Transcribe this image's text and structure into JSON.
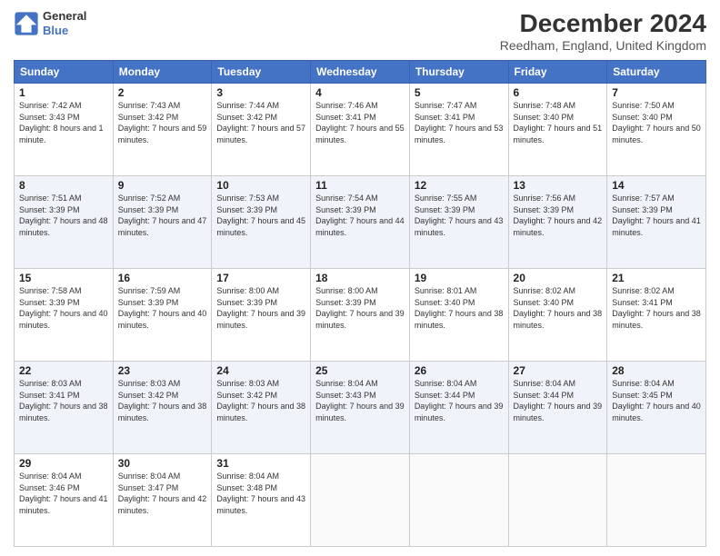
{
  "header": {
    "logo": {
      "line1": "General",
      "line2": "Blue"
    },
    "title": "December 2024",
    "subtitle": "Reedham, England, United Kingdom"
  },
  "calendar": {
    "columns": [
      "Sunday",
      "Monday",
      "Tuesday",
      "Wednesday",
      "Thursday",
      "Friday",
      "Saturday"
    ],
    "weeks": [
      [
        {
          "day": "1",
          "sunrise": "7:42 AM",
          "sunset": "3:43 PM",
          "daylight": "8 hours and 1 minute."
        },
        {
          "day": "2",
          "sunrise": "7:43 AM",
          "sunset": "3:42 PM",
          "daylight": "7 hours and 59 minutes."
        },
        {
          "day": "3",
          "sunrise": "7:44 AM",
          "sunset": "3:42 PM",
          "daylight": "7 hours and 57 minutes."
        },
        {
          "day": "4",
          "sunrise": "7:46 AM",
          "sunset": "3:41 PM",
          "daylight": "7 hours and 55 minutes."
        },
        {
          "day": "5",
          "sunrise": "7:47 AM",
          "sunset": "3:41 PM",
          "daylight": "7 hours and 53 minutes."
        },
        {
          "day": "6",
          "sunrise": "7:48 AM",
          "sunset": "3:40 PM",
          "daylight": "7 hours and 51 minutes."
        },
        {
          "day": "7",
          "sunrise": "7:50 AM",
          "sunset": "3:40 PM",
          "daylight": "7 hours and 50 minutes."
        }
      ],
      [
        {
          "day": "8",
          "sunrise": "7:51 AM",
          "sunset": "3:39 PM",
          "daylight": "7 hours and 48 minutes."
        },
        {
          "day": "9",
          "sunrise": "7:52 AM",
          "sunset": "3:39 PM",
          "daylight": "7 hours and 47 minutes."
        },
        {
          "day": "10",
          "sunrise": "7:53 AM",
          "sunset": "3:39 PM",
          "daylight": "7 hours and 45 minutes."
        },
        {
          "day": "11",
          "sunrise": "7:54 AM",
          "sunset": "3:39 PM",
          "daylight": "7 hours and 44 minutes."
        },
        {
          "day": "12",
          "sunrise": "7:55 AM",
          "sunset": "3:39 PM",
          "daylight": "7 hours and 43 minutes."
        },
        {
          "day": "13",
          "sunrise": "7:56 AM",
          "sunset": "3:39 PM",
          "daylight": "7 hours and 42 minutes."
        },
        {
          "day": "14",
          "sunrise": "7:57 AM",
          "sunset": "3:39 PM",
          "daylight": "7 hours and 41 minutes."
        }
      ],
      [
        {
          "day": "15",
          "sunrise": "7:58 AM",
          "sunset": "3:39 PM",
          "daylight": "7 hours and 40 minutes."
        },
        {
          "day": "16",
          "sunrise": "7:59 AM",
          "sunset": "3:39 PM",
          "daylight": "7 hours and 40 minutes."
        },
        {
          "day": "17",
          "sunrise": "8:00 AM",
          "sunset": "3:39 PM",
          "daylight": "7 hours and 39 minutes."
        },
        {
          "day": "18",
          "sunrise": "8:00 AM",
          "sunset": "3:39 PM",
          "daylight": "7 hours and 39 minutes."
        },
        {
          "day": "19",
          "sunrise": "8:01 AM",
          "sunset": "3:40 PM",
          "daylight": "7 hours and 38 minutes."
        },
        {
          "day": "20",
          "sunrise": "8:02 AM",
          "sunset": "3:40 PM",
          "daylight": "7 hours and 38 minutes."
        },
        {
          "day": "21",
          "sunrise": "8:02 AM",
          "sunset": "3:41 PM",
          "daylight": "7 hours and 38 minutes."
        }
      ],
      [
        {
          "day": "22",
          "sunrise": "8:03 AM",
          "sunset": "3:41 PM",
          "daylight": "7 hours and 38 minutes."
        },
        {
          "day": "23",
          "sunrise": "8:03 AM",
          "sunset": "3:42 PM",
          "daylight": "7 hours and 38 minutes."
        },
        {
          "day": "24",
          "sunrise": "8:03 AM",
          "sunset": "3:42 PM",
          "daylight": "7 hours and 38 minutes."
        },
        {
          "day": "25",
          "sunrise": "8:04 AM",
          "sunset": "3:43 PM",
          "daylight": "7 hours and 39 minutes."
        },
        {
          "day": "26",
          "sunrise": "8:04 AM",
          "sunset": "3:44 PM",
          "daylight": "7 hours and 39 minutes."
        },
        {
          "day": "27",
          "sunrise": "8:04 AM",
          "sunset": "3:44 PM",
          "daylight": "7 hours and 39 minutes."
        },
        {
          "day": "28",
          "sunrise": "8:04 AM",
          "sunset": "3:45 PM",
          "daylight": "7 hours and 40 minutes."
        }
      ],
      [
        {
          "day": "29",
          "sunrise": "8:04 AM",
          "sunset": "3:46 PM",
          "daylight": "7 hours and 41 minutes."
        },
        {
          "day": "30",
          "sunrise": "8:04 AM",
          "sunset": "3:47 PM",
          "daylight": "7 hours and 42 minutes."
        },
        {
          "day": "31",
          "sunrise": "8:04 AM",
          "sunset": "3:48 PM",
          "daylight": "7 hours and 43 minutes."
        },
        null,
        null,
        null,
        null
      ]
    ]
  }
}
